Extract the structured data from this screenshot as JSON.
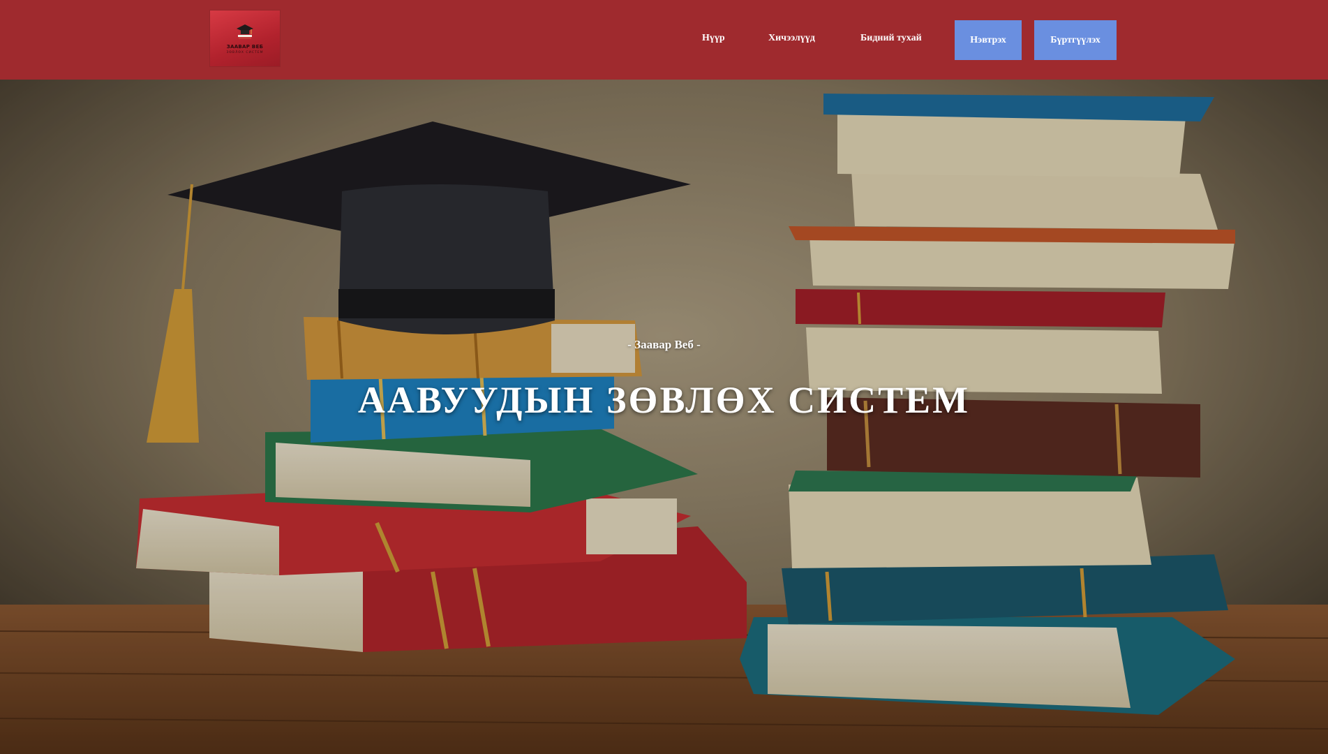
{
  "brand": {
    "logo_title": "ЗААВАР ВЕБ",
    "logo_subtitle": "ЗӨВЛӨХ СИСТЕМ",
    "accent_color": "#9f2a2e"
  },
  "nav": {
    "home": "Нүүр",
    "lessons": "Хичээлүүд",
    "about": "Бидний тухай",
    "login": "Нэвтрэх",
    "register": "Бүртгүүлэх",
    "button_color": "#6a8fe0"
  },
  "hero": {
    "subtitle": "- Заавар Веб -",
    "title": "ААВУУДЫН ЗӨВЛӨХ СИСТЕМ",
    "background": "graduation-cap-on-stacked-books"
  }
}
